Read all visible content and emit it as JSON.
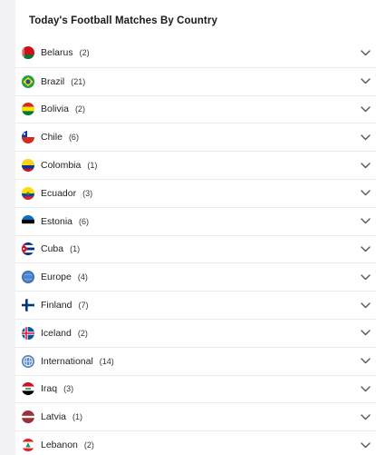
{
  "panel": {
    "title": "Today's Football Matches By Country"
  },
  "countries": [
    {
      "name": "Belarus",
      "count": "(2)",
      "flag": "belarus"
    },
    {
      "name": "Brazil",
      "count": "(21)",
      "flag": "brazil"
    },
    {
      "name": "Bolivia",
      "count": "(2)",
      "flag": "bolivia"
    },
    {
      "name": "Chile",
      "count": "(6)",
      "flag": "chile"
    },
    {
      "name": "Colombia",
      "count": "(1)",
      "flag": "colombia"
    },
    {
      "name": "Ecuador",
      "count": "(3)",
      "flag": "ecuador"
    },
    {
      "name": "Estonia",
      "count": "(6)",
      "flag": "estonia"
    },
    {
      "name": "Cuba",
      "count": "(1)",
      "flag": "cuba"
    },
    {
      "name": "Europe",
      "count": "(4)",
      "flag": "europe"
    },
    {
      "name": "Finland",
      "count": "(7)",
      "flag": "finland"
    },
    {
      "name": "Iceland",
      "count": "(2)",
      "flag": "iceland"
    },
    {
      "name": "International",
      "count": "(14)",
      "flag": "international"
    },
    {
      "name": "Iraq",
      "count": "(3)",
      "flag": "iraq"
    },
    {
      "name": "Latvia",
      "count": "(1)",
      "flag": "latvia"
    },
    {
      "name": "Lebanon",
      "count": "(2)",
      "flag": "lebanon"
    }
  ],
  "icons": {
    "expand": "chevron-down-icon"
  },
  "colors": {
    "chevron": "#555555",
    "divider": "#ebebee",
    "background": "#f2f2f4"
  }
}
